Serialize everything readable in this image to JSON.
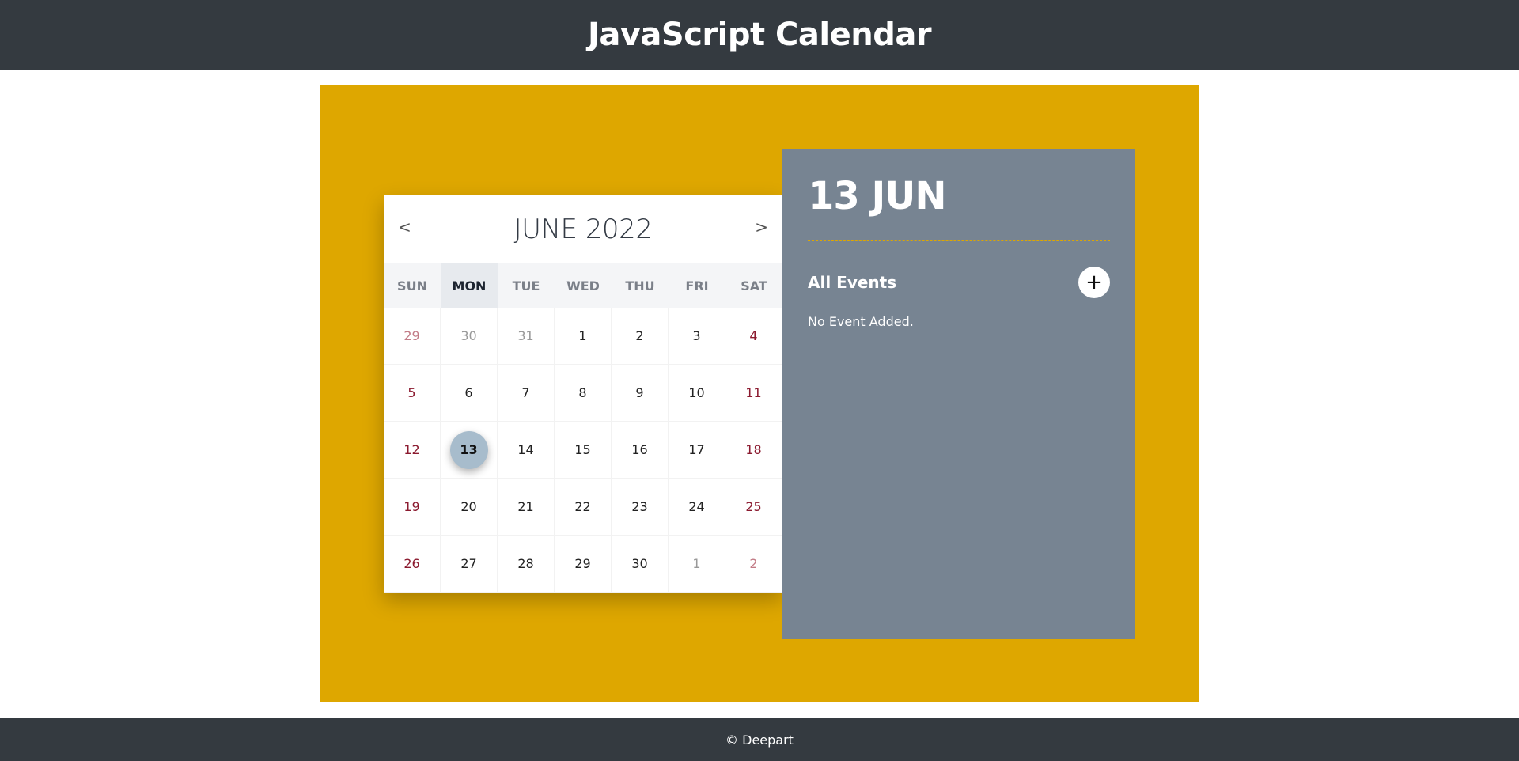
{
  "header": {
    "title": "JavaScript Calendar"
  },
  "calendar": {
    "month_label": "JUNE 2022",
    "prev_label": "<",
    "next_label": ">",
    "weekdays": [
      "SUN",
      "MON",
      "TUE",
      "WED",
      "THU",
      "FRI",
      "SAT"
    ],
    "active_weekday_index": 1,
    "weeks": [
      [
        {
          "d": "29",
          "other": true
        },
        {
          "d": "30",
          "other": true
        },
        {
          "d": "31",
          "other": true
        },
        {
          "d": "1"
        },
        {
          "d": "2"
        },
        {
          "d": "3"
        },
        {
          "d": "4"
        }
      ],
      [
        {
          "d": "5"
        },
        {
          "d": "6"
        },
        {
          "d": "7"
        },
        {
          "d": "8"
        },
        {
          "d": "9"
        },
        {
          "d": "10"
        },
        {
          "d": "11"
        }
      ],
      [
        {
          "d": "12"
        },
        {
          "d": "13",
          "today": true
        },
        {
          "d": "14"
        },
        {
          "d": "15"
        },
        {
          "d": "16"
        },
        {
          "d": "17"
        },
        {
          "d": "18"
        }
      ],
      [
        {
          "d": "19"
        },
        {
          "d": "20"
        },
        {
          "d": "21"
        },
        {
          "d": "22"
        },
        {
          "d": "23"
        },
        {
          "d": "24"
        },
        {
          "d": "25"
        }
      ],
      [
        {
          "d": "26"
        },
        {
          "d": "27"
        },
        {
          "d": "28"
        },
        {
          "d": "29"
        },
        {
          "d": "30"
        },
        {
          "d": "1",
          "other": true
        },
        {
          "d": "2",
          "other": true
        }
      ]
    ]
  },
  "panel": {
    "date_label": "13 JUN",
    "events_title": "All Events",
    "add_label": "+",
    "empty_text": "No Event Added."
  },
  "footer": {
    "text": "© Deepart"
  },
  "colors": {
    "header_bg": "#343a40",
    "stage_bg": "#dea700",
    "panel_bg": "#778492",
    "today_circle": "#a7bccc",
    "weekend_text": "#8b1a2f"
  }
}
